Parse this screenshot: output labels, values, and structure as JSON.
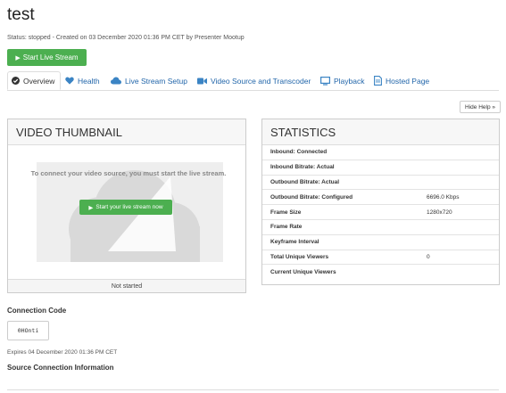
{
  "page": {
    "title": "test",
    "status": "Status: stopped - Created on 03 December 2020 01:36 PM CET by Presenter Mootup"
  },
  "actions": {
    "start_live_stream": "Start Live Stream",
    "hide_help": "Hide Help »"
  },
  "tabs": [
    {
      "label": "Overview",
      "icon": "check-circle-icon",
      "active": true
    },
    {
      "label": "Health",
      "icon": "heart-icon"
    },
    {
      "label": "Live Stream Setup",
      "icon": "cloud-icon"
    },
    {
      "label": "Video Source and Transcoder",
      "icon": "video-camera-icon"
    },
    {
      "label": "Playback",
      "icon": "monitor-icon"
    },
    {
      "label": "Hosted Page",
      "icon": "document-icon"
    }
  ],
  "thumbnail": {
    "heading": "VIDEO THUMBNAIL",
    "message": "To connect your video source, you must start the live stream.",
    "button": "Start your live stream now",
    "status": "Not started"
  },
  "statistics": {
    "heading": "STATISTICS",
    "rows": [
      {
        "label": "Inbound: Connected",
        "value": ""
      },
      {
        "label": "Inbound Bitrate: Actual",
        "value": ""
      },
      {
        "label": "Outbound Bitrate: Actual",
        "value": ""
      },
      {
        "label": "Outbound Bitrate: Configured",
        "value": "6696.0 Kbps"
      },
      {
        "label": "Frame Size",
        "value": "1280x720"
      },
      {
        "label": "Frame Rate",
        "value": ""
      },
      {
        "label": "Keyframe Interval",
        "value": ""
      },
      {
        "label": "Total Unique Viewers",
        "value": "0"
      },
      {
        "label": "Current Unique Viewers",
        "value": ""
      }
    ]
  },
  "connection": {
    "label": "Connection Code",
    "code": "0HOnti",
    "expires": "Expires 04 December 2020 01:36 PM CET",
    "source_label": "Source Connection Information"
  },
  "colors": {
    "accent": "#4caf50",
    "link": "#2266aa",
    "icon": "#3b84c4"
  }
}
